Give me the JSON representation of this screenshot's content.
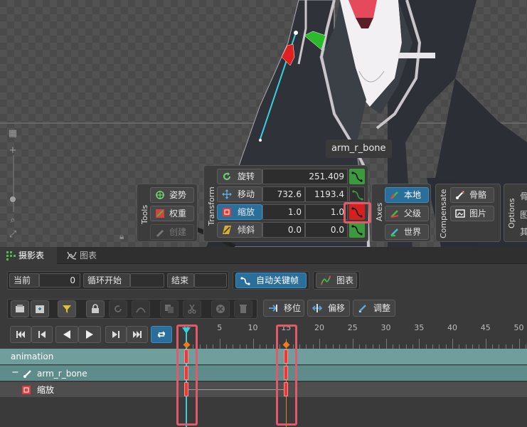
{
  "viewport": {
    "bone_label": "arm_r_bone"
  },
  "tools_panel": {
    "title": "Tools",
    "buttons": [
      {
        "label": "姿势",
        "icon": "pose-icon"
      },
      {
        "label": "权重",
        "icon": "weight-icon"
      },
      {
        "label": "创建",
        "icon": "create-icon",
        "disabled": true
      }
    ]
  },
  "transform_panel": {
    "title": "Transform",
    "rows": [
      {
        "label": "旋转",
        "icon": "rotate-icon",
        "v1": "",
        "v2": "251.409",
        "selected": false,
        "key": "green"
      },
      {
        "label": "移动",
        "icon": "move-icon",
        "v1": "732.6",
        "v2": "1193.4",
        "selected": false,
        "key": "dark"
      },
      {
        "label": "缩放",
        "icon": "scale-icon",
        "v1": "1.0",
        "v2": "1.0",
        "selected": true,
        "key": "red"
      },
      {
        "label": "倾斜",
        "icon": "shear-icon",
        "v1": "0.0",
        "v2": "0.0",
        "selected": false,
        "key": "green"
      }
    ]
  },
  "axes_panel": {
    "title": "Axes",
    "buttons": [
      {
        "label": "本地",
        "icon": "local-axis-icon",
        "active": true
      },
      {
        "label": "父级",
        "icon": "parent-axis-icon",
        "active": false
      },
      {
        "label": "世界",
        "icon": "world-axis-icon",
        "active": false
      }
    ]
  },
  "compensate_panel": {
    "title": "Compensate",
    "buttons": [
      {
        "label": "骨骼",
        "icon": "bone-icon"
      },
      {
        "label": "图片",
        "icon": "image-icon"
      }
    ]
  },
  "options_panel": {
    "title": "Options",
    "items": [
      "骨",
      "图",
      "其"
    ]
  },
  "tabs": [
    {
      "label": "摄影表",
      "icon": "dopesheet-icon",
      "active": true
    },
    {
      "label": "图表",
      "icon": "graph-icon",
      "active": false
    }
  ],
  "controls": {
    "current_label": "当前",
    "current_value": "0",
    "loop_start_label": "循环开始",
    "loop_start_value": "",
    "end_label": "结束",
    "end_value": "",
    "autokey_label": "自动关键帧",
    "graph_label": "图表",
    "offset_label": "移位",
    "shift_label": "偏移",
    "adjust_label": "调整"
  },
  "ruler": {
    "labels": [
      "0",
      "5",
      "10",
      "15",
      "20",
      "25",
      "30",
      "35",
      "40",
      "45",
      "50"
    ],
    "current_frame": 0
  },
  "tracks": [
    {
      "name": "animation",
      "type": "animation"
    },
    {
      "name": "arm_r_bone",
      "type": "bone"
    },
    {
      "name": "缩放",
      "type": "property"
    }
  ],
  "keyframes": [
    0,
    15
  ],
  "colors": {
    "accent_blue": "#2a6f9c",
    "key_green": "#3b9a3b",
    "key_red": "#d62020",
    "highlight_box": "#e05a6a",
    "track_teal": "#6f9e9d",
    "track_teal_dark": "#5d8c8b",
    "playhead": "#38d0d8"
  }
}
